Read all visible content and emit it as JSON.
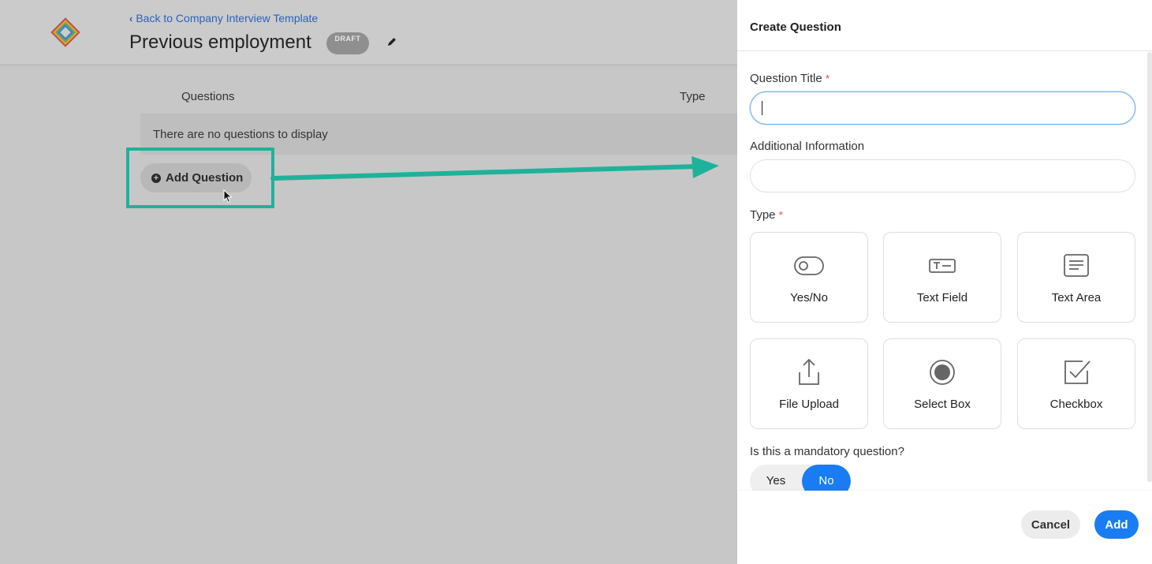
{
  "header": {
    "back_link": "Back to Company Interview Template",
    "title": "Previous employment",
    "status_badge": "DRAFT"
  },
  "table": {
    "columns": [
      "Questions",
      "Type"
    ],
    "empty_message": "There are no questions to display"
  },
  "add_question_label": "Add Question",
  "annotation_color": "#1fb29a",
  "panel": {
    "title": "Create Question",
    "question_title_label": "Question Title",
    "required_mark": "*",
    "question_title_value": "",
    "additional_info_label": "Additional Information",
    "additional_info_value": "",
    "type_label": "Type",
    "types": [
      {
        "label": "Yes/No",
        "icon": "toggle-icon"
      },
      {
        "label": "Text Field",
        "icon": "text-field-icon"
      },
      {
        "label": "Text Area",
        "icon": "text-area-icon"
      },
      {
        "label": "File Upload",
        "icon": "upload-icon"
      },
      {
        "label": "Select Box",
        "icon": "radio-icon"
      },
      {
        "label": "Checkbox",
        "icon": "checkbox-icon"
      }
    ],
    "mandatory_label": "Is this a mandatory question?",
    "mandatory_options": [
      "Yes",
      "No"
    ],
    "mandatory_selected": "No",
    "cancel_label": "Cancel",
    "add_label": "Add",
    "accent": "#1a7cf2"
  }
}
